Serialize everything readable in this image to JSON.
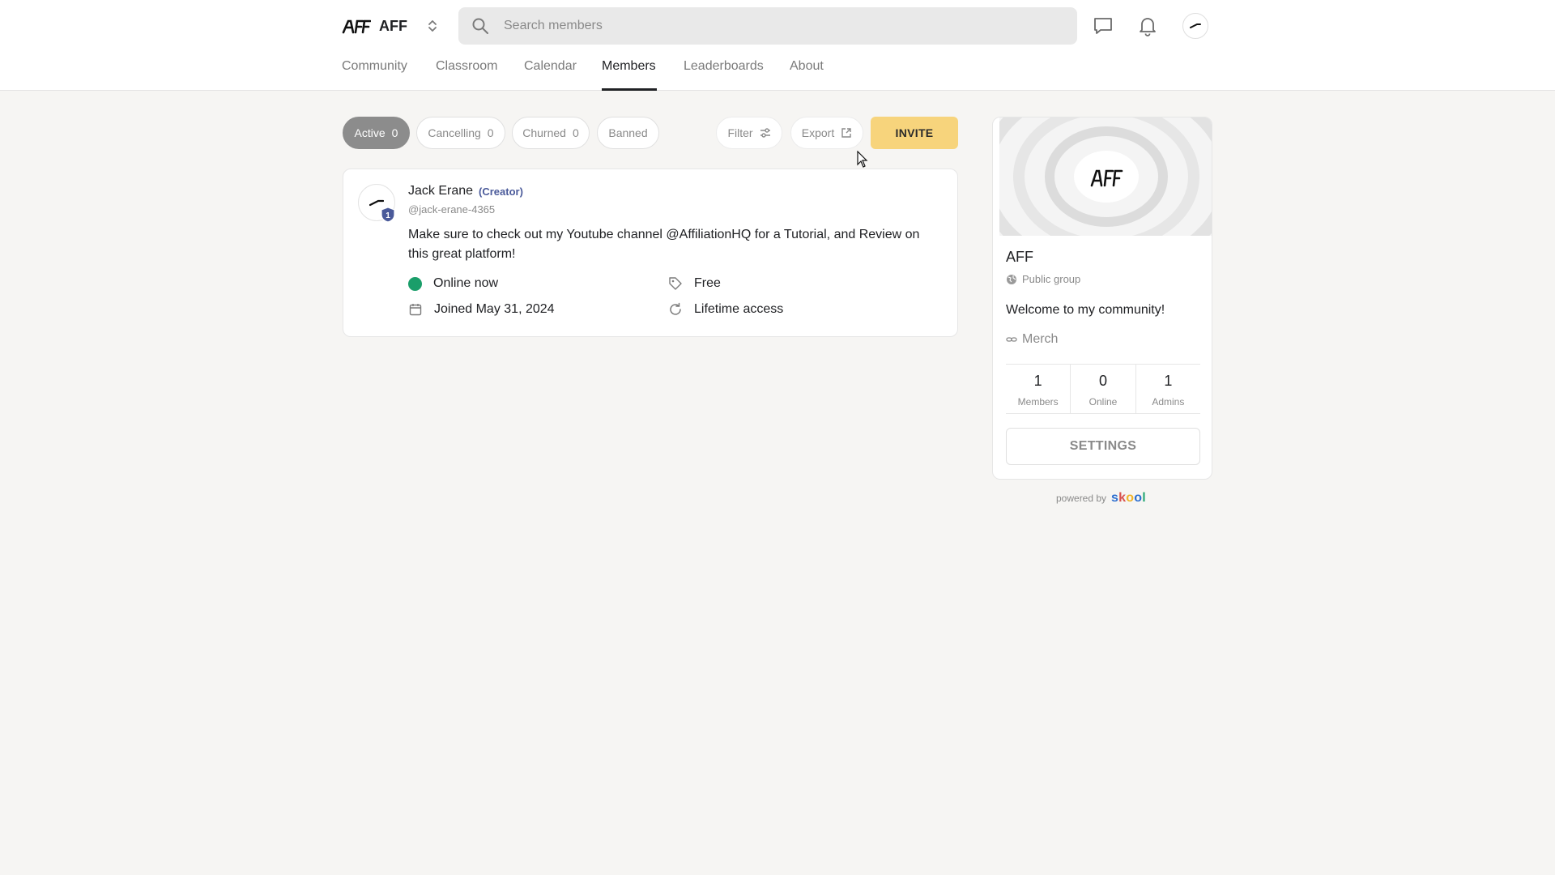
{
  "header": {
    "brand_name": "AFF",
    "search_placeholder": "Search members",
    "tabs": [
      {
        "label": "Community"
      },
      {
        "label": "Classroom"
      },
      {
        "label": "Calendar"
      },
      {
        "label": "Members",
        "active": true
      },
      {
        "label": "Leaderboards"
      },
      {
        "label": "About"
      }
    ]
  },
  "filters": {
    "active": {
      "label": "Active",
      "count": "0"
    },
    "cancelling": {
      "label": "Cancelling",
      "count": "0"
    },
    "churned": {
      "label": "Churned",
      "count": "0"
    },
    "banned": {
      "label": "Banned"
    },
    "filter_label": "Filter",
    "export_label": "Export",
    "invite_label": "INVITE"
  },
  "member": {
    "name": "Jack Erane",
    "role": "(Creator)",
    "handle": "@jack-erane-4365",
    "level": "1",
    "bio": "Make sure to check out my Youtube channel @AffiliationHQ for a Tutorial, and Review on this great platform!",
    "status": "Online now",
    "joined": "Joined May 31, 2024",
    "plan": "Free",
    "access": "Lifetime access"
  },
  "group": {
    "name": "AFF",
    "type": "Public group",
    "description": "Welcome to my community!",
    "link_label": "Merch",
    "stats": [
      {
        "value": "1",
        "label": "Members"
      },
      {
        "value": "0",
        "label": "Online"
      },
      {
        "value": "1",
        "label": "Admins"
      }
    ],
    "settings_label": "SETTINGS"
  },
  "footer": {
    "powered_by": "powered by",
    "skool_letters": [
      "s",
      "k",
      "o",
      "o",
      "l"
    ]
  },
  "colors": {
    "accent_invite": "#f7d47c",
    "online_green": "#1a9e6a",
    "active_pill": "#8c8c8c",
    "creator_text": "#4a5a9a",
    "skool_letters": [
      "#2e6fcf",
      "#d9534f",
      "#f0b429",
      "#2e6fcf",
      "#2aa876"
    ]
  }
}
